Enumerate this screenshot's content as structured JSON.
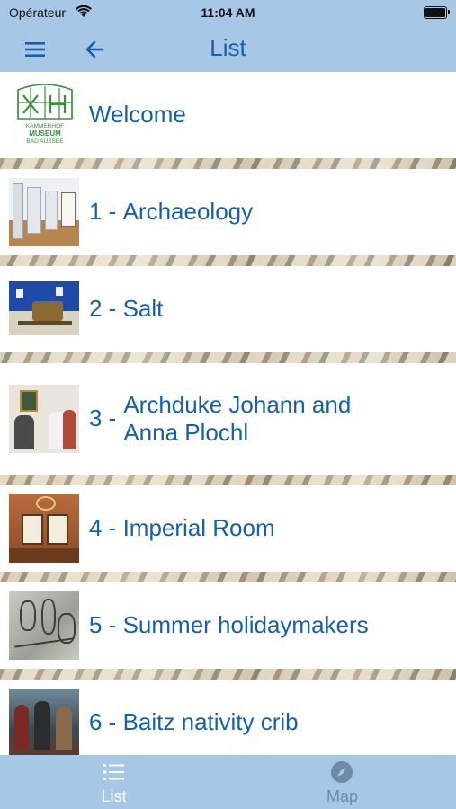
{
  "status": {
    "carrier": "Opérateur",
    "time": "11:04 AM"
  },
  "nav": {
    "title": "List"
  },
  "welcome": {
    "label": "Welcome",
    "logo_text_top": "KAMMERHOF",
    "logo_text_mid": "MUSEUM",
    "logo_text_bot": "BAD AUSSEE"
  },
  "items": [
    {
      "number": "1 -",
      "title": "Archaeology"
    },
    {
      "number": "2 -",
      "title": "Salt"
    },
    {
      "number": "3 -",
      "title": "Archduke Johann and Anna Plochl"
    },
    {
      "number": "4 -",
      "title": "Imperial Room"
    },
    {
      "number": "5 -",
      "title": "Summer holidaymakers"
    },
    {
      "number": "6 -",
      "title": "Baitz nativity crib"
    }
  ],
  "tabs": [
    {
      "label": "List",
      "icon": "list-icon"
    },
    {
      "label": "Map",
      "icon": "compass-icon"
    }
  ],
  "colors": {
    "bar": "#a7c7e7",
    "accent": "#1560a8",
    "tab_active": "#ffffff",
    "tab_inactive": "#6f8aa6"
  }
}
